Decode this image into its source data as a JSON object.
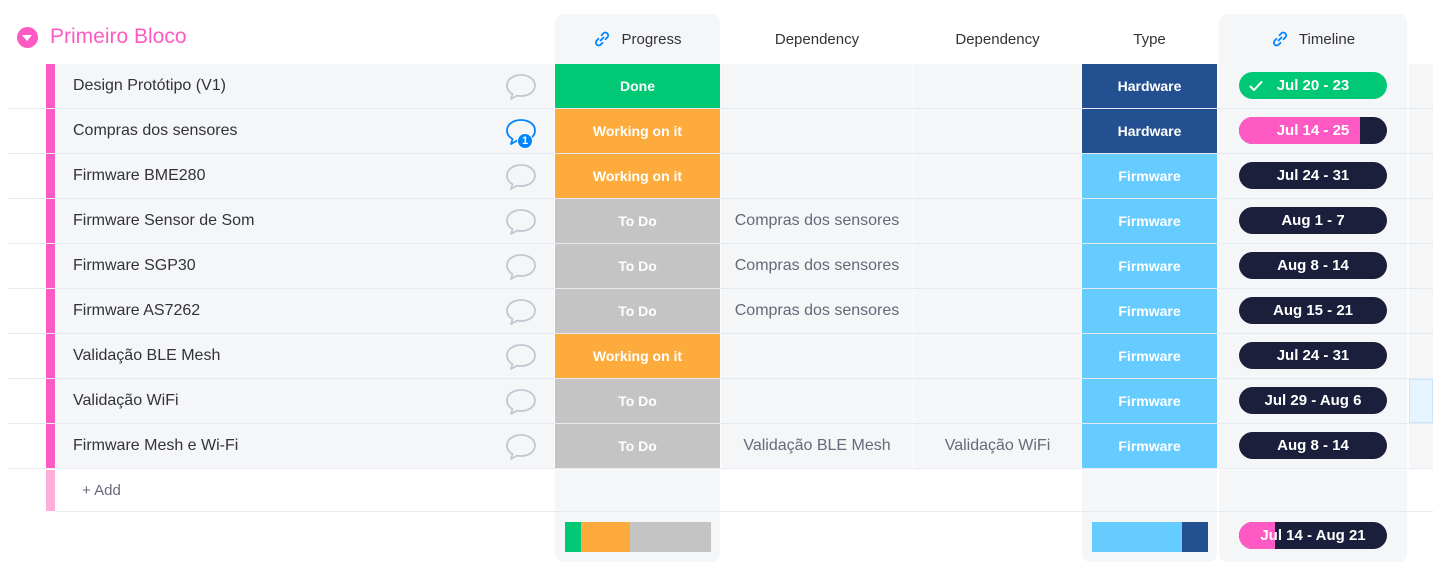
{
  "group": {
    "title": "Primeiro Bloco",
    "color": "#ff5ac4"
  },
  "columns": {
    "progress": "Progress",
    "dependency1": "Dependency",
    "dependency2": "Dependency",
    "type": "Type",
    "timeline": "Timeline"
  },
  "colors": {
    "done": "#00c875",
    "working": "#fdab3d",
    "todo": "#c4c4c4",
    "hardware": "#225091",
    "firmware": "#66ccff",
    "timeline_dark": "#1c1f3b",
    "timeline_pink": "#ff5ac4",
    "chat_active": "#0085ff"
  },
  "rows": [
    {
      "name": "Design Protótipo (V1)",
      "updates": "",
      "status": "Done",
      "status_key": "done",
      "dep1": "",
      "dep2": "",
      "type": "Hardware",
      "type_key": "hardware",
      "timeline": "Jul 20 - 23",
      "timeline_style": "done",
      "timeline_progress": 1
    },
    {
      "name": "Compras dos sensores",
      "updates": "1",
      "status": "Working on it",
      "status_key": "working",
      "dep1": "",
      "dep2": "",
      "type": "Hardware",
      "type_key": "hardware",
      "timeline": "Jul 14 - 25",
      "timeline_style": "partial",
      "timeline_progress": 0.82
    },
    {
      "name": "Firmware BME280",
      "updates": "",
      "status": "Working on it",
      "status_key": "working",
      "dep1": "",
      "dep2": "",
      "type": "Firmware",
      "type_key": "firmware",
      "timeline": "Jul 24 - 31",
      "timeline_style": "future",
      "timeline_progress": 0
    },
    {
      "name": "Firmware Sensor de Som",
      "updates": "",
      "status": "To Do",
      "status_key": "todo",
      "dep1": "Compras dos sensores",
      "dep2": "",
      "type": "Firmware",
      "type_key": "firmware",
      "timeline": "Aug 1 - 7",
      "timeline_style": "future",
      "timeline_progress": 0
    },
    {
      "name": "Firmware SGP30",
      "updates": "",
      "status": "To Do",
      "status_key": "todo",
      "dep1": "Compras dos sensores",
      "dep2": "",
      "type": "Firmware",
      "type_key": "firmware",
      "timeline": "Aug 8 - 14",
      "timeline_style": "future",
      "timeline_progress": 0
    },
    {
      "name": "Firmware AS7262",
      "updates": "",
      "status": "To Do",
      "status_key": "todo",
      "dep1": "Compras dos sensores",
      "dep2": "",
      "type": "Firmware",
      "type_key": "firmware",
      "timeline": "Aug 15 - 21",
      "timeline_style": "future",
      "timeline_progress": 0
    },
    {
      "name": "Validação BLE Mesh",
      "updates": "",
      "status": "Working on it",
      "status_key": "working",
      "dep1": "",
      "dep2": "",
      "type": "Firmware",
      "type_key": "firmware",
      "timeline": "Jul 24 - 31",
      "timeline_style": "future",
      "timeline_progress": 0
    },
    {
      "name": "Validação WiFi",
      "updates": "",
      "status": "To Do",
      "status_key": "todo",
      "dep1": "",
      "dep2": "",
      "type": "Firmware",
      "type_key": "firmware",
      "timeline": "Jul 29 - Aug 6",
      "timeline_style": "future",
      "timeline_progress": 0
    },
    {
      "name": "Firmware Mesh e Wi-Fi",
      "updates": "",
      "status": "To Do",
      "status_key": "todo",
      "dep1": "Validação BLE Mesh",
      "dep2": "Validação WiFi",
      "type": "Firmware",
      "type_key": "firmware",
      "timeline": "Aug 8 - 14",
      "timeline_style": "future",
      "timeline_progress": 0
    }
  ],
  "add_row": {
    "label": "+ Add"
  },
  "summary": {
    "progress_distribution": [
      {
        "status": "Done",
        "fraction": 0.111,
        "color": "#00c875"
      },
      {
        "status": "Working on it",
        "fraction": 0.333,
        "color": "#fdab3d"
      },
      {
        "status": "To Do",
        "fraction": 0.556,
        "color": "#c4c4c4"
      }
    ],
    "type_distribution": [
      {
        "type": "Firmware",
        "fraction": 0.778,
        "color": "#66ccff"
      },
      {
        "type": "Hardware",
        "fraction": 0.222,
        "color": "#225091"
      }
    ],
    "timeline": "Jul 14 - Aug 21",
    "timeline_progress": 0.24
  }
}
